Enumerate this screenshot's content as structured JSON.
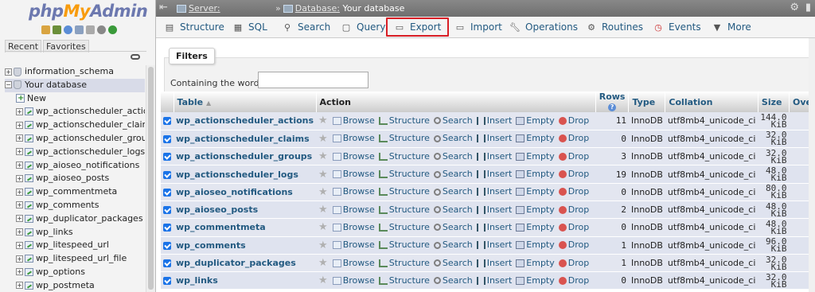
{
  "sidebar": {
    "logo": {
      "php": "php",
      "my": "My",
      "admin": "Admin"
    },
    "tabs": [
      "Recent",
      "Favorites"
    ],
    "tree": [
      {
        "label": "information_schema",
        "type": "db",
        "toggle": "+"
      },
      {
        "label": "Your database",
        "type": "db",
        "toggle": "−",
        "selected": true
      },
      {
        "label": "New",
        "type": "new"
      },
      {
        "label": "wp_actionscheduler_actions",
        "type": "table",
        "toggle": "+"
      },
      {
        "label": "wp_actionscheduler_claims",
        "type": "table",
        "toggle": "+"
      },
      {
        "label": "wp_actionscheduler_groups",
        "type": "table",
        "toggle": "+"
      },
      {
        "label": "wp_actionscheduler_logs",
        "type": "table",
        "toggle": "+"
      },
      {
        "label": "wp_aioseo_notifications",
        "type": "table",
        "toggle": "+"
      },
      {
        "label": "wp_aioseo_posts",
        "type": "table",
        "toggle": "+"
      },
      {
        "label": "wp_commentmeta",
        "type": "table",
        "toggle": "+"
      },
      {
        "label": "wp_comments",
        "type": "table",
        "toggle": "+"
      },
      {
        "label": "wp_duplicator_packages",
        "type": "table",
        "toggle": "+"
      },
      {
        "label": "wp_links",
        "type": "table",
        "toggle": "+"
      },
      {
        "label": "wp_litespeed_url",
        "type": "table",
        "toggle": "+"
      },
      {
        "label": "wp_litespeed_url_file",
        "type": "table",
        "toggle": "+"
      },
      {
        "label": "wp_options",
        "type": "table",
        "toggle": "+"
      },
      {
        "label": "wp_postmeta",
        "type": "table",
        "toggle": "+"
      }
    ]
  },
  "topbar": {
    "server_label": "Server:",
    "database_label": "Database:",
    "database_value": "Your database"
  },
  "menu": {
    "structure": "Structure",
    "sql": "SQL",
    "search": "Search",
    "query": "Query",
    "export": "Export",
    "import": "Import",
    "operations": "Operations",
    "routines": "Routines",
    "events": "Events",
    "more": "More"
  },
  "filters": {
    "legend": "Filters",
    "label": "Containing the word:",
    "value": ""
  },
  "table": {
    "headers": {
      "table": "Table",
      "action": "Action",
      "rows": "Rows",
      "type": "Type",
      "collation": "Collation",
      "size": "Size",
      "overhead": "Overhead"
    },
    "actions": {
      "browse": "Browse",
      "structure": "Structure",
      "search": "Search",
      "insert": "Insert",
      "empty": "Empty",
      "drop": "Drop"
    },
    "rows": [
      {
        "name": "wp_actionscheduler_actions",
        "rows": "11",
        "type": "InnoDB",
        "collation": "utf8mb4_unicode_ci",
        "size": "144.0",
        "unit": "KiB",
        "overhead": "-"
      },
      {
        "name": "wp_actionscheduler_claims",
        "rows": "0",
        "type": "InnoDB",
        "collation": "utf8mb4_unicode_ci",
        "size": "32.0",
        "unit": "KiB",
        "overhead": "-"
      },
      {
        "name": "wp_actionscheduler_groups",
        "rows": "3",
        "type": "InnoDB",
        "collation": "utf8mb4_unicode_ci",
        "size": "32.0",
        "unit": "KiB",
        "overhead": "-"
      },
      {
        "name": "wp_actionscheduler_logs",
        "rows": "19",
        "type": "InnoDB",
        "collation": "utf8mb4_unicode_ci",
        "size": "48.0",
        "unit": "KiB",
        "overhead": "-"
      },
      {
        "name": "wp_aioseo_notifications",
        "rows": "0",
        "type": "InnoDB",
        "collation": "utf8mb4_unicode_ci",
        "size": "80.0",
        "unit": "KiB",
        "overhead": "-"
      },
      {
        "name": "wp_aioseo_posts",
        "rows": "2",
        "type": "InnoDB",
        "collation": "utf8mb4_unicode_ci",
        "size": "48.0",
        "unit": "KiB",
        "overhead": "-"
      },
      {
        "name": "wp_commentmeta",
        "rows": "0",
        "type": "InnoDB",
        "collation": "utf8mb4_unicode_ci",
        "size": "48.0",
        "unit": "KiB",
        "overhead": "-"
      },
      {
        "name": "wp_comments",
        "rows": "1",
        "type": "InnoDB",
        "collation": "utf8mb4_unicode_ci",
        "size": "96.0",
        "unit": "KiB",
        "overhead": "-"
      },
      {
        "name": "wp_duplicator_packages",
        "rows": "1",
        "type": "InnoDB",
        "collation": "utf8mb4_unicode_ci",
        "size": "32.0",
        "unit": "KiB",
        "overhead": "-"
      },
      {
        "name": "wp_links",
        "rows": "0",
        "type": "InnoDB",
        "collation": "utf8mb4_unicode_ci",
        "size": "32.0",
        "unit": "KiB",
        "overhead": "-"
      }
    ]
  },
  "colors": {
    "link": "#235a81",
    "highlight_border": "#d81f26",
    "logo_blue": "#6c78af",
    "logo_orange": "#f89c0e"
  }
}
